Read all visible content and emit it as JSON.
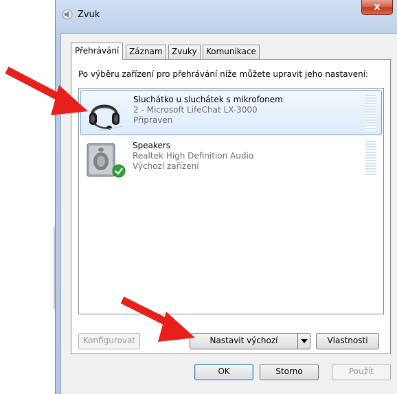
{
  "window": {
    "title": "Zvuk",
    "close_glyph": "x"
  },
  "tabs": [
    {
      "label": "Přehrávání",
      "active": true
    },
    {
      "label": "Záznam",
      "active": false
    },
    {
      "label": "Zvuky",
      "active": false
    },
    {
      "label": "Komunikace",
      "active": false
    }
  ],
  "panel": {
    "instruction": "Po výběru zařízení pro přehrávání níže můžete upravit jeho nastavení:"
  },
  "devices": [
    {
      "name": "Sluchátko u sluchátek s mikrofonem",
      "description": "2 - Microsoft LifeChat LX-3000",
      "status": "Připraven",
      "icon": "headset-icon",
      "selected": true
    },
    {
      "name": "Speakers",
      "description": "Realtek High Definition Audio",
      "status": "Výchozí zařízení",
      "icon": "speaker-icon",
      "selected": false
    }
  ],
  "buttons": {
    "configure": "Konfigurovat",
    "set_default": "Nastavit výchozí",
    "properties": "Vlastnosti",
    "ok": "OK",
    "cancel": "Storno",
    "apply": "Použít"
  },
  "colors": {
    "annotation_arrow": "#e8201c",
    "selection_border": "#7da2ce",
    "default_check": "#2aa43a"
  }
}
